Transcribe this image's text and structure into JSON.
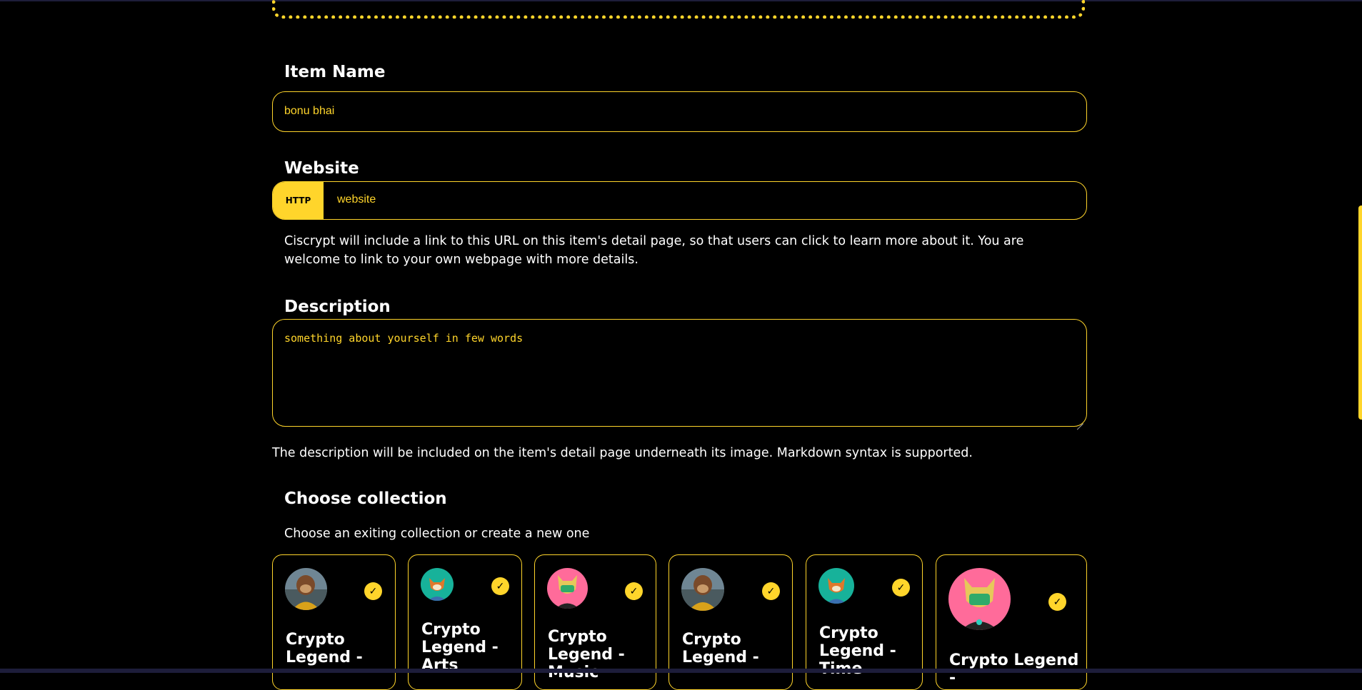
{
  "form": {
    "item_name": {
      "label": "Item Name",
      "value": "bonu bhai"
    },
    "website": {
      "label": "Website",
      "prefix": "HTTP",
      "value": "website",
      "help": "Ciscrypt will include a link to this URL on this item's detail page, so that users can click to learn more about it. You are welcome to link to your own webpage with more details."
    },
    "description": {
      "label": "Description",
      "placeholder": "something about yourself in few words",
      "help": "The description will be included on the item's detail page underneath its image. Markdown syntax is supported."
    },
    "collection": {
      "label": "Choose collection",
      "subtitle": "Choose an exiting collection or create a new one",
      "cards": [
        {
          "title": "Crypto Legend -",
          "avatar": "ape-avatar"
        },
        {
          "title": "Crypto Legend - Arts",
          "avatar": "fox-teal-avatar"
        },
        {
          "title": "Crypto Legend - Music",
          "avatar": "fox-pink-avatar"
        },
        {
          "title": "Crypto Legend -",
          "avatar": "ape-avatar"
        },
        {
          "title": "Crypto Legend - Time",
          "avatar": "fox-teal-avatar"
        },
        {
          "title": "Crypto Legend -",
          "avatar": "fox-pink-avatar"
        }
      ]
    }
  },
  "colors": {
    "accent": "#ffd52b",
    "background": "#000000",
    "text": "#ffffff"
  }
}
